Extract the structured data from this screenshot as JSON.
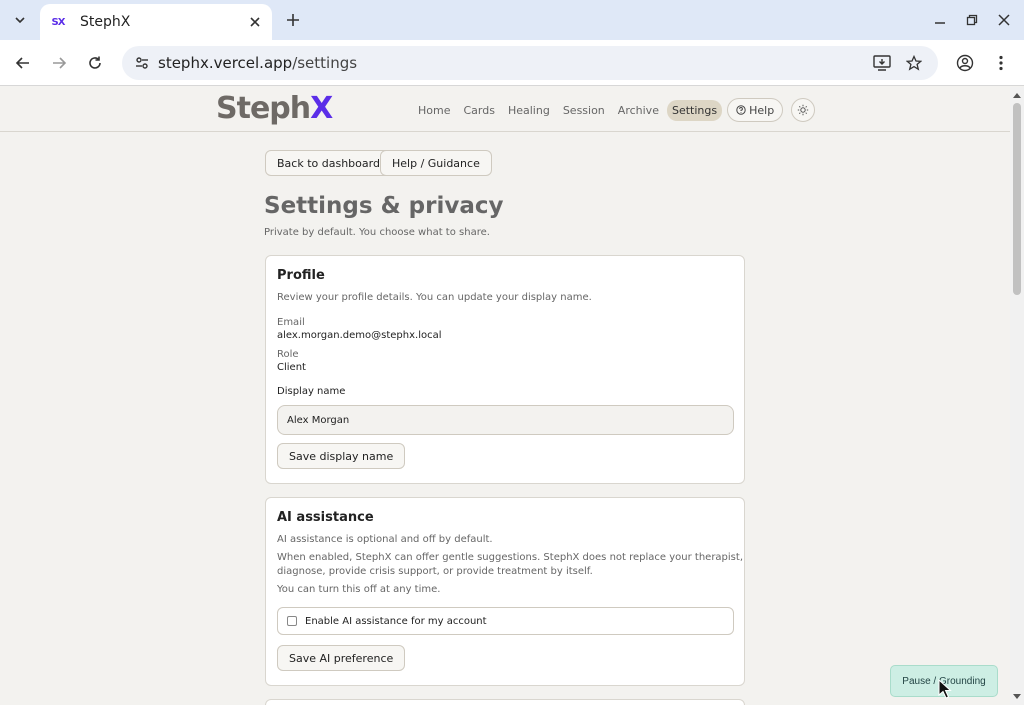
{
  "browser": {
    "tab_title": "StephX",
    "favicon_text": "SX",
    "url_host": "stephx.vercel.app",
    "url_path": "/settings"
  },
  "header": {
    "logo_main": "Steph",
    "logo_accent": "X",
    "nav": [
      "Home",
      "Cards",
      "Healing",
      "Session",
      "Archive",
      "Settings"
    ],
    "active_nav": "Settings",
    "help_label": "Help"
  },
  "actions": {
    "back": "Back to dashboard",
    "help": "Help / Guidance"
  },
  "page": {
    "title": "Settings & privacy",
    "subtitle": "Private by default. You choose what to share."
  },
  "profile": {
    "title": "Profile",
    "description": "Review your profile details. You can update your display name.",
    "email_label": "Email",
    "email_value": "alex.morgan.demo@stephx.local",
    "role_label": "Role",
    "role_value": "Client",
    "display_name_label": "Display name",
    "display_name_value": "Alex Morgan",
    "save_label": "Save display name"
  },
  "ai": {
    "title": "AI assistance",
    "line1": "AI assistance is optional and off by default.",
    "line2a": "When enabled, StephX can offer gentle suggestions. StephX does not replace your therapist,",
    "line2b": "diagnose, provide crisis support, or provide treatment by itself.",
    "line3": "You can turn this off at any time.",
    "checkbox_label": "Enable AI assistance for my account",
    "checkbox_checked": false,
    "save_label": "Save AI preference"
  },
  "floating": {
    "pause_label": "Pause / Grounding"
  },
  "colors": {
    "accent": "#5b2ee8",
    "nav_active_bg": "#ddd6c5",
    "pause_bg": "#cdeee4",
    "page_bg": "#f3f2ef"
  }
}
